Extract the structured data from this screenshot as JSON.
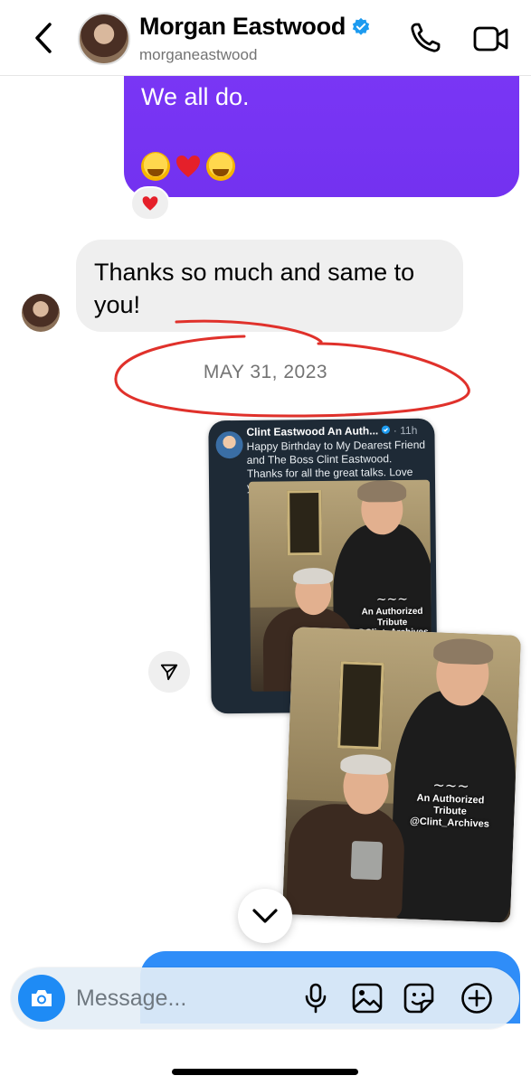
{
  "header": {
    "name": "Morgan Eastwood",
    "username": "morganeastwood",
    "icons": [
      "back-chevron-icon",
      "verified-badge-icon",
      "phone-icon",
      "video-camera-icon"
    ]
  },
  "messages": {
    "outgoing_text": "We all do.",
    "reaction": "heart",
    "incoming_text": "Thanks so much and same to you!"
  },
  "date_divider": "MAY 31, 2023",
  "shared_post": {
    "account": "Clint Eastwood An Auth...",
    "age": "11h",
    "caption": "Happy Birthday to My Dearest Friend and The Boss Clint Eastwood. Thanks for all the great talks. Love you Pal..",
    "watermark_line1": "An Authorized",
    "watermark_line2": "Tribute",
    "watermark_line3": "@Clint_Archives"
  },
  "composer": {
    "placeholder": "Message...",
    "icons": [
      "camera-icon",
      "microphone-icon",
      "gallery-icon",
      "sticker-icon",
      "add-icon"
    ]
  },
  "colors": {
    "outgoing_bubble": "#7332f0",
    "incoming_bubble": "#efefef",
    "blue_bubble": "#2f8df8",
    "camera_button": "#1e8bf5",
    "annotation": "#e0312b"
  }
}
